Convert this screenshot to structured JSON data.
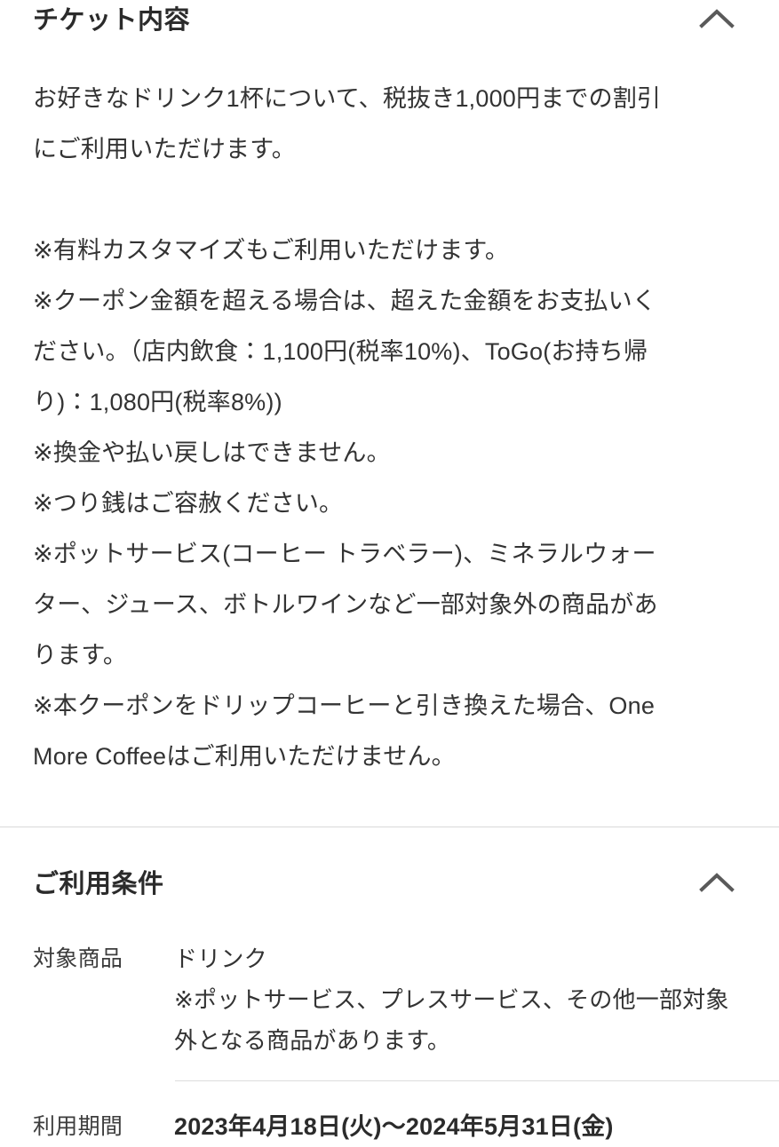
{
  "sections": [
    {
      "id": "ticket-contents",
      "title": "チケット内容",
      "toggle_icon": "chevron-up-icon",
      "expanded": true,
      "paragraphs": [
        "お好きなドリンク1杯について、税抜き1,000円までの割引\nにご利用いただけます。",
        "※有料カスタマイズもご利用いただけます。\n※クーポン金額を超える場合は、超えた金額をお支払いく\nださい。（店内飲食：1,100円(税率10%)、ToGo(お持ち帰\nり)：1,080円(税率8%))\n※換金や払い戻しはできません。\n※つり銭はご容赦ください。\n※ポットサービス(コーヒー トラベラー)、ミネラルウォー\nター、ジュース、ボトルワインなど一部対象外の商品があ\nります。\n※本クーポンをドリップコーヒーと引き換えた場合、One\nMore Coffeeはご利用いただけません。"
      ]
    },
    {
      "id": "usage-conditions",
      "title": "ご利用条件",
      "toggle_icon": "chevron-up-icon",
      "expanded": true,
      "rows": [
        {
          "term": "対象商品",
          "value": "ドリンク\n※ポットサービス、プレスサービス、その他一部対象\n外となる商品があります。",
          "bold": false
        },
        {
          "term": "利用期間",
          "value": "2023年4月18日(火)〜2024年5月31日(金)",
          "bold": true
        }
      ]
    }
  ],
  "colors": {
    "text": "#333333",
    "heading": "#2b2b2b",
    "label": "#3d3d3d",
    "divider": "#d9d9d9",
    "divider_inner": "#dcdcdc",
    "icon": "#5a5a5a",
    "background": "#ffffff"
  }
}
